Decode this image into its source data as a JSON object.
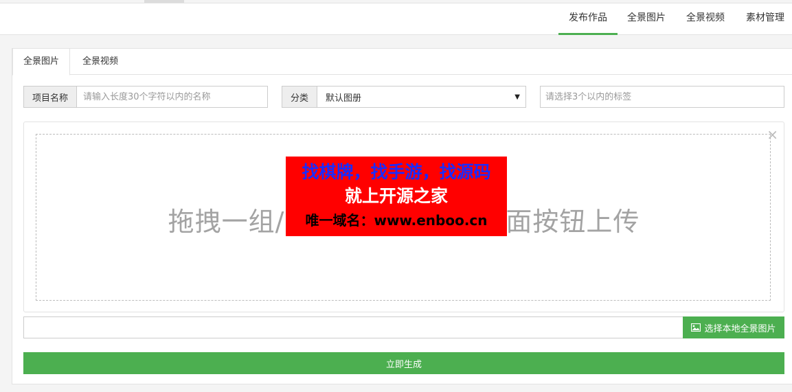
{
  "nav": {
    "items": [
      {
        "label": "发布作品",
        "active": true
      },
      {
        "label": "全景图片",
        "active": false
      },
      {
        "label": "全景视频",
        "active": false
      },
      {
        "label": "素材管理",
        "active": false
      }
    ]
  },
  "tabs": [
    {
      "label": "全景图片",
      "active": true
    },
    {
      "label": "全景视频",
      "active": false
    }
  ],
  "form": {
    "project_name_label": "项目名称",
    "project_name_placeholder": "请输入长度30个字符以内的名称",
    "category_label": "分类",
    "category_selected": "默认图册",
    "tags_placeholder": "请选择3个以内的标签"
  },
  "dropzone": {
    "left_text": "拖拽一组/",
    "right_text": "面按钮上传",
    "close_symbol": "×"
  },
  "watermark": {
    "line1": "找棋牌，找手游，找源码",
    "line2": "就上开源之家",
    "line3": "唯一域名：www.enboo.cn"
  },
  "file_picker": {
    "button_label": "选择本地全景图片",
    "icon": "image-icon"
  },
  "submit_label": "立即生成",
  "colors": {
    "accent": "#4caf50",
    "watermark_bg": "#ff0000",
    "watermark_line1": "#1a2bff"
  }
}
